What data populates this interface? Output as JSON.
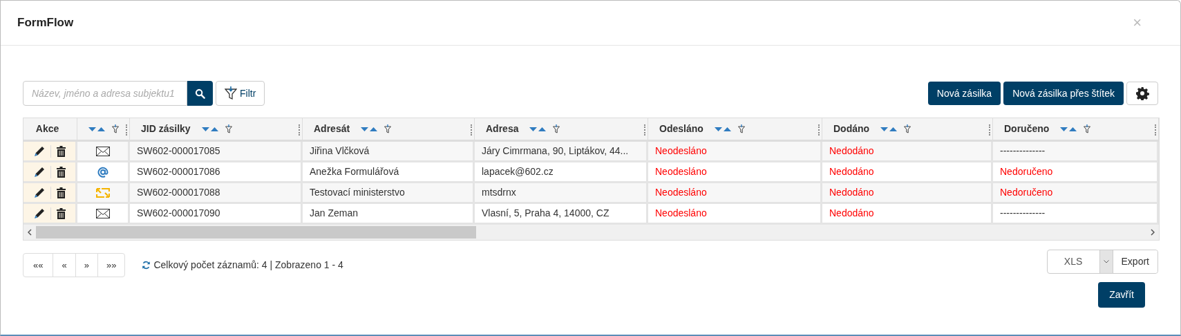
{
  "window": {
    "title": "FormFlow",
    "close": "×"
  },
  "search": {
    "placeholder": "Název, jméno a adresa subjektu1"
  },
  "filter_button": "Filtr",
  "buttons": [
    "Nová zásilka",
    "Nová zásilka přes štítek"
  ],
  "table": {
    "columns": [
      {
        "label": "Akce",
        "sortable": false
      },
      {
        "sortable": true
      },
      {
        "label": "JID zásilky",
        "sortable": true
      },
      {
        "label": "Adresát",
        "sortable": true
      },
      {
        "label": "Adresa",
        "sortable": true
      },
      {
        "label": "Odesláno",
        "sortable": true
      },
      {
        "label": "Dodáno",
        "sortable": true
      },
      {
        "label": "Doručeno",
        "sortable": true
      }
    ],
    "rows": [
      {
        "kind": "post",
        "jid": "SW602-000017085",
        "recipient": "Jiřina Vlčková",
        "address": "Járy Cimrmana, 90, Liptákov, 44...",
        "sent": {
          "text": "Neodesláno",
          "alert": true
        },
        "delivered": {
          "text": "Nedodáno",
          "alert": true
        },
        "received": {
          "text": "--------------",
          "alert": false
        }
      },
      {
        "kind": "email",
        "jid": "SW602-000017086",
        "recipient": "Anežka Formulářová",
        "address": "lapacek@602.cz",
        "sent": {
          "text": "Neodesláno",
          "alert": true
        },
        "delivered": {
          "text": "Nedodáno",
          "alert": true
        },
        "received": {
          "text": "Nedoručeno",
          "alert": true
        }
      },
      {
        "kind": "databox",
        "jid": "SW602-000017088",
        "recipient": "Testovací ministerstvo",
        "address": "mtsdrnx",
        "sent": {
          "text": "Neodesláno",
          "alert": true
        },
        "delivered": {
          "text": "Nedodáno",
          "alert": true
        },
        "received": {
          "text": "Nedoručeno",
          "alert": true
        }
      },
      {
        "kind": "post",
        "jid": "SW602-000017090",
        "recipient": "Jan Zeman",
        "address": "Vlasní, 5, Praha 4, 14000, CZ",
        "sent": {
          "text": "Neodesláno",
          "alert": true
        },
        "delivered": {
          "text": "Nedodáno",
          "alert": true
        },
        "received": {
          "text": "--------------",
          "alert": false
        }
      }
    ]
  },
  "pagination": [
    "««",
    "«",
    "»",
    "»»"
  ],
  "record_count": "Celkový počet záznamů: 4 | Zobrazeno 1 - 4",
  "export": {
    "format": "XLS",
    "button": "Export"
  },
  "close_button": "Zavřít"
}
